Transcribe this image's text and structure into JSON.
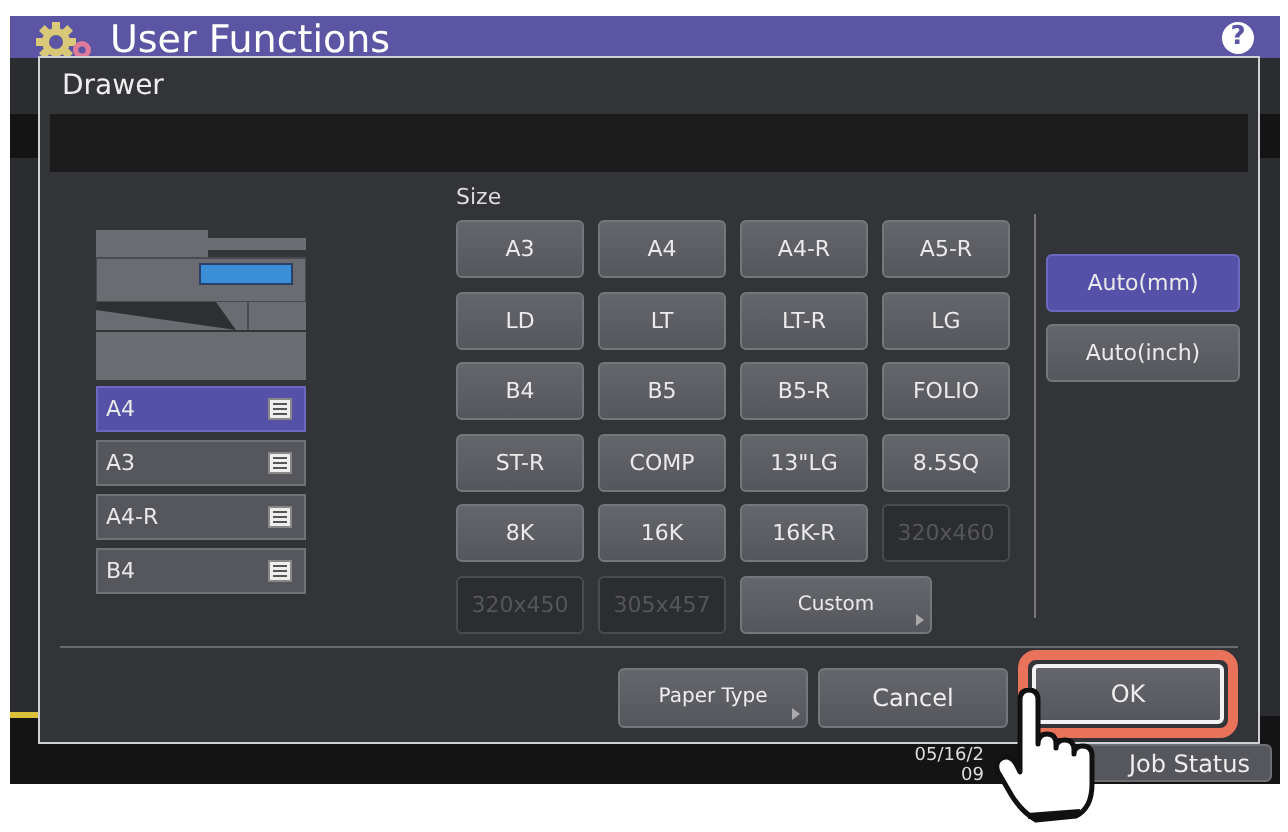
{
  "header": {
    "title": "User Functions",
    "help": "?"
  },
  "dialog": {
    "title": "Drawer",
    "drawers": [
      {
        "label": "A4",
        "selected": true
      },
      {
        "label": "A3",
        "selected": false
      },
      {
        "label": "A4-R",
        "selected": false
      },
      {
        "label": "B4",
        "selected": false
      }
    ],
    "size_label": "Size",
    "sizes": [
      {
        "label": "A3",
        "kind": "size",
        "disabled": false
      },
      {
        "label": "A4",
        "kind": "size",
        "disabled": false
      },
      {
        "label": "A4-R",
        "kind": "size",
        "disabled": false
      },
      {
        "label": "A5-R",
        "kind": "size",
        "disabled": false
      },
      {
        "label": "LD",
        "kind": "size",
        "disabled": false
      },
      {
        "label": "LT",
        "kind": "size",
        "disabled": false
      },
      {
        "label": "LT-R",
        "kind": "size",
        "disabled": false
      },
      {
        "label": "LG",
        "kind": "size",
        "disabled": false
      },
      {
        "label": "B4",
        "kind": "size",
        "disabled": false
      },
      {
        "label": "B5",
        "kind": "size",
        "disabled": false
      },
      {
        "label": "B5-R",
        "kind": "size",
        "disabled": false
      },
      {
        "label": "FOLIO",
        "kind": "size",
        "disabled": false
      },
      {
        "label": "ST-R",
        "kind": "size",
        "disabled": false
      },
      {
        "label": "COMP",
        "kind": "size",
        "disabled": false
      },
      {
        "label": "13\"LG",
        "kind": "size",
        "disabled": false
      },
      {
        "label": "8.5SQ",
        "kind": "size",
        "disabled": false
      },
      {
        "label": "8K",
        "kind": "size",
        "disabled": false
      },
      {
        "label": "16K",
        "kind": "size",
        "disabled": false
      },
      {
        "label": "16K-R",
        "kind": "size",
        "disabled": false
      },
      {
        "label": "320x460",
        "kind": "size",
        "disabled": true
      },
      {
        "label": "320x450",
        "kind": "size",
        "disabled": true
      },
      {
        "label": "305x457",
        "kind": "size",
        "disabled": true
      },
      {
        "label": "Custom",
        "kind": "menu",
        "disabled": false
      }
    ],
    "auto_options": [
      {
        "label": "Auto(mm)",
        "selected": true
      },
      {
        "label": "Auto(inch)",
        "selected": false
      }
    ],
    "buttons": [
      {
        "label": "Paper Type",
        "kind": "menu",
        "highlighted": false
      },
      {
        "label": "Cancel",
        "kind": "plain",
        "highlighted": false
      },
      {
        "label": "OK",
        "kind": "plain",
        "highlighted": true
      }
    ]
  },
  "status_bar": {
    "date": "05/16/2",
    "time": "09",
    "job_status": "Job Status"
  }
}
